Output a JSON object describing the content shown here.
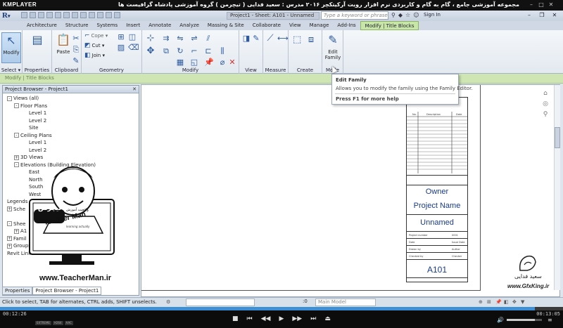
{
  "player": {
    "logo": "KMPLAYER",
    "title": "مجموعه آموزشی جامع ، گام به گام و کاربردی نرم افزار رویت آرکیتکچر ۲۰۱۶   مدرس : سعید فدایی ( تیچرمن ) گروه آموزشی پادشاه گرافیست ها",
    "time_current": "00:12:26",
    "time_total": "00:13:05",
    "progress": 0.95,
    "volume": 0.8,
    "badges": [
      "EXTREME",
      "H264",
      "AAC"
    ]
  },
  "app": {
    "doc_title": "Project1 - Sheet: A101 - Unnamed",
    "search_placeholder": "Type a keyword or phrase",
    "sign_in": "Sign In",
    "tabs": [
      "Architecture",
      "Structure",
      "Systems",
      "Insert",
      "Annotate",
      "Analyze",
      "Massing & Site",
      "Collaborate",
      "View",
      "Manage",
      "Add-Ins"
    ],
    "context_tab": "Modify | Title Blocks",
    "context_bar_label": "Modify | Title Blocks"
  },
  "ribbon": {
    "modify_label": "Modify",
    "properties_label": "Properties",
    "paste_label": "Paste",
    "cope_label": "Cope",
    "cut_label": "Cut",
    "join_label": "Join",
    "edit_family_label": "Edit Family",
    "panels": {
      "select": "Select",
      "properties": "Properties",
      "clipboard": "Clipboard",
      "geometry": "Geometry",
      "modify": "Modify",
      "view": "View",
      "measure": "Measure",
      "create": "Create",
      "mode": "Mode"
    }
  },
  "tooltip": {
    "title": "Edit Family",
    "description": "Allows you to modify the family using the Family Editor.",
    "help": "Press F1 for more help"
  },
  "browser": {
    "header": "Project Browser - Project1",
    "nodes": [
      {
        "label": "Views (all)",
        "level": 0,
        "exp": "-"
      },
      {
        "label": "Floor Plans",
        "level": 1,
        "exp": "-"
      },
      {
        "label": "Level 1",
        "level": 2,
        "exp": ""
      },
      {
        "label": "Level 2",
        "level": 2,
        "exp": ""
      },
      {
        "label": "Site",
        "level": 2,
        "exp": ""
      },
      {
        "label": "Ceiling Plans",
        "level": 1,
        "exp": "-"
      },
      {
        "label": "Level 1",
        "level": 2,
        "exp": ""
      },
      {
        "label": "Level 2",
        "level": 2,
        "exp": ""
      },
      {
        "label": "3D Views",
        "level": 1,
        "exp": "+"
      },
      {
        "label": "Elevations (Building Elevation)",
        "level": 1,
        "exp": "-"
      },
      {
        "label": "East",
        "level": 2,
        "exp": ""
      },
      {
        "label": "North",
        "level": 2,
        "exp": ""
      },
      {
        "label": "South",
        "level": 2,
        "exp": ""
      },
      {
        "label": "West",
        "level": 2,
        "exp": ""
      },
      {
        "label": "Legends",
        "level": 0,
        "exp": ""
      },
      {
        "label": "Sche",
        "level": 0,
        "exp": "+"
      },
      {
        "label": "",
        "level": 0,
        "exp": ""
      },
      {
        "label": "Shee",
        "level": 0,
        "exp": "-"
      },
      {
        "label": "A1",
        "level": 1,
        "exp": "+"
      },
      {
        "label": "Famil",
        "level": 0,
        "exp": "+"
      },
      {
        "label": "Groups",
        "level": 0,
        "exp": "+"
      },
      {
        "label": "Revit Links",
        "level": 0,
        "exp": ""
      }
    ],
    "tabs": [
      "Properties",
      "Project Browser - Project1"
    ]
  },
  "watermark": {
    "brand_fa": "تیچرمن",
    "brand_sub_fa": "واقعیت آموزش",
    "brand_en": "Teacher Man",
    "tagline": "learning actually",
    "website": "www.TeacherMan.ir"
  },
  "titleblock": {
    "owner": "Owner",
    "project_name": "Project Name",
    "unnamed": "Unnamed",
    "sheet_number": "A101",
    "rev_headers": [
      "No.",
      "Description",
      "Date"
    ],
    "fields": [
      "Project number",
      "Date",
      "Drawn by",
      "Checked by"
    ],
    "values": [
      "0001",
      "Issue Date",
      "Author",
      "Checker"
    ]
  },
  "logo": {
    "name_fa": "سعید فدایی",
    "site": "www.GfxKing.ir"
  },
  "status": {
    "text": "Click to select, TAB for alternates, CTRL adds, SHIFT unselects.",
    "zero": ":0",
    "model": "Main Model"
  }
}
